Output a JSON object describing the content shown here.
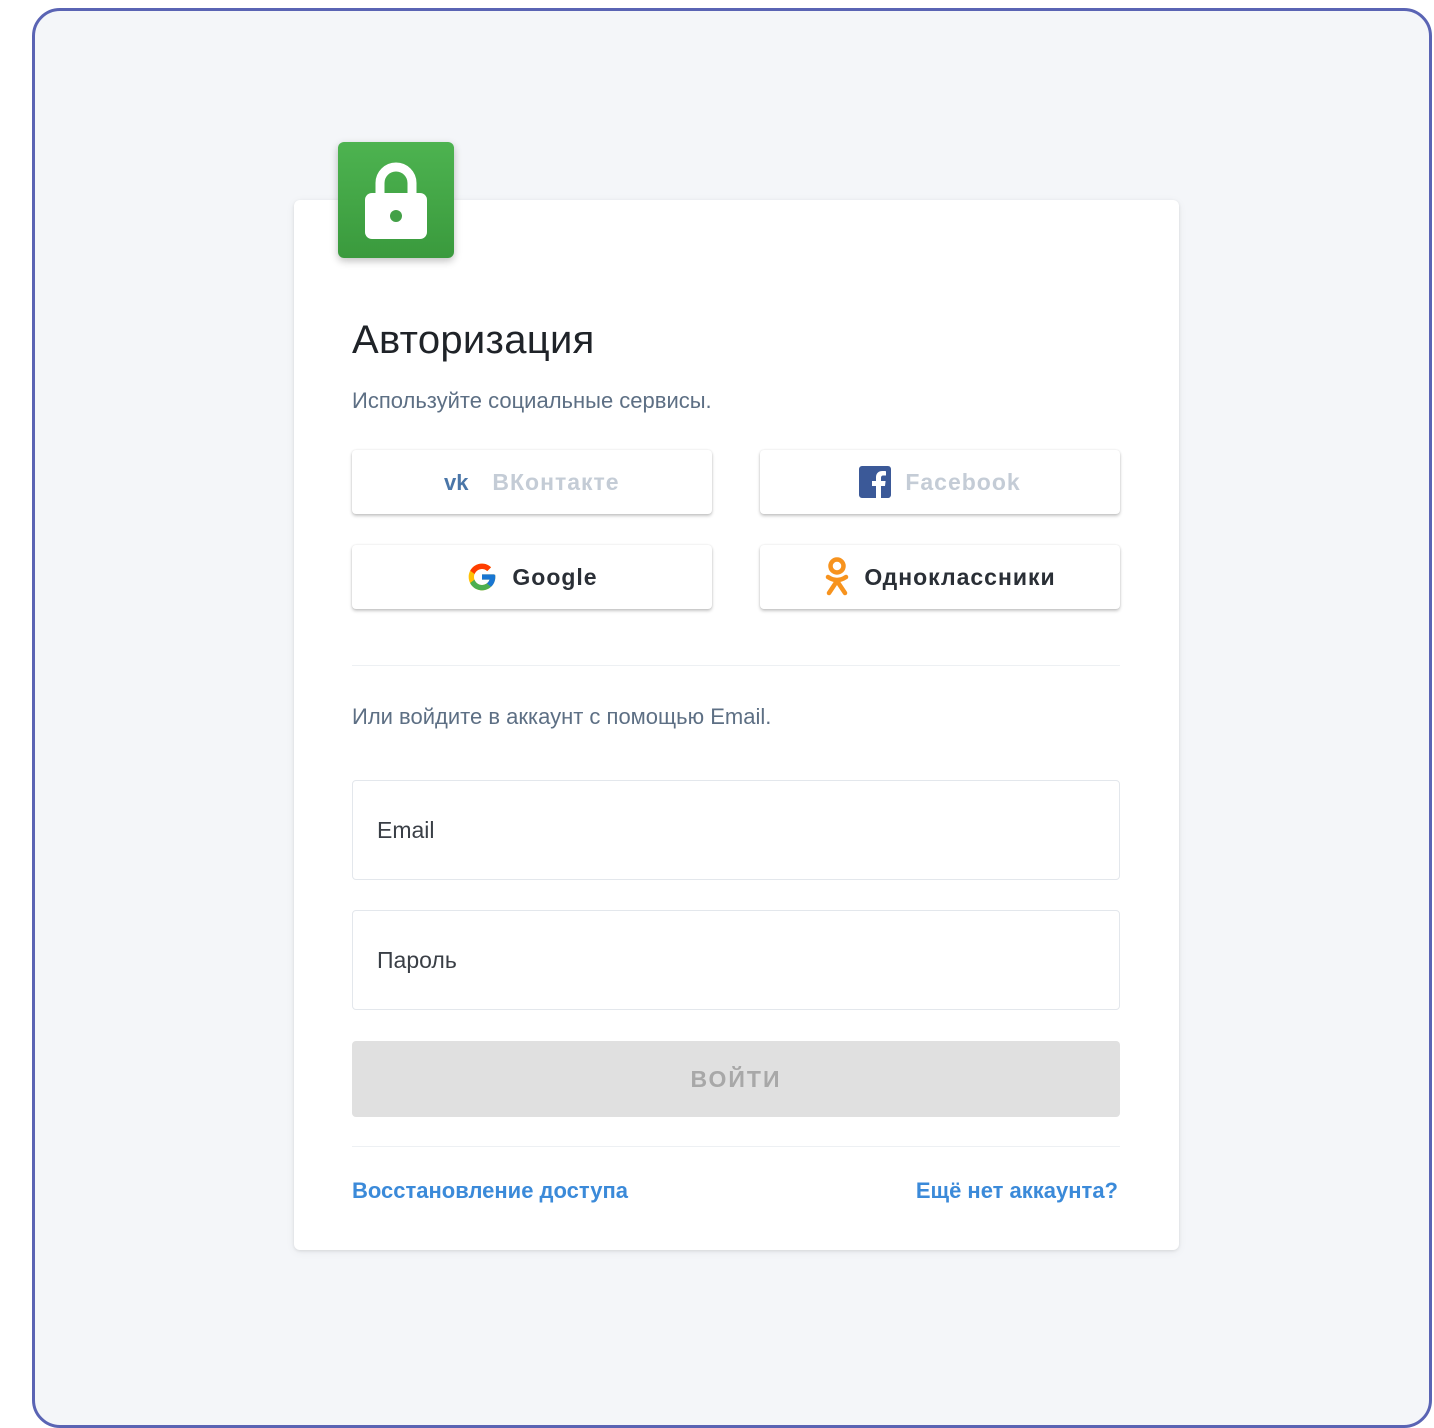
{
  "title": "Авторизация",
  "subtitle": "Используйте социальные сервисы.",
  "social": {
    "vk": {
      "label": "ВКонтакте",
      "icon": "vk-icon",
      "disabled": true
    },
    "facebook": {
      "label": "Facebook",
      "icon": "facebook-icon",
      "disabled": true
    },
    "google": {
      "label": "Google",
      "icon": "google-icon",
      "disabled": false
    },
    "ok": {
      "label": "Одноклассники",
      "icon": "odnoklassniki-icon",
      "disabled": false
    }
  },
  "email_hint": "Или войдите в аккаунт с помощью Email.",
  "form": {
    "email_placeholder": "Email",
    "password_placeholder": "Пароль",
    "submit_label": "ВОЙТИ"
  },
  "links": {
    "recover": "Восстановление доступа",
    "register": "Ещё нет аккаунта?"
  },
  "colors": {
    "brand_green": "#43a047",
    "link_blue": "#3b8ad9",
    "frame_border": "#5a64b4",
    "ok_orange": "#f7931e",
    "fb_blue": "#3b5998"
  }
}
